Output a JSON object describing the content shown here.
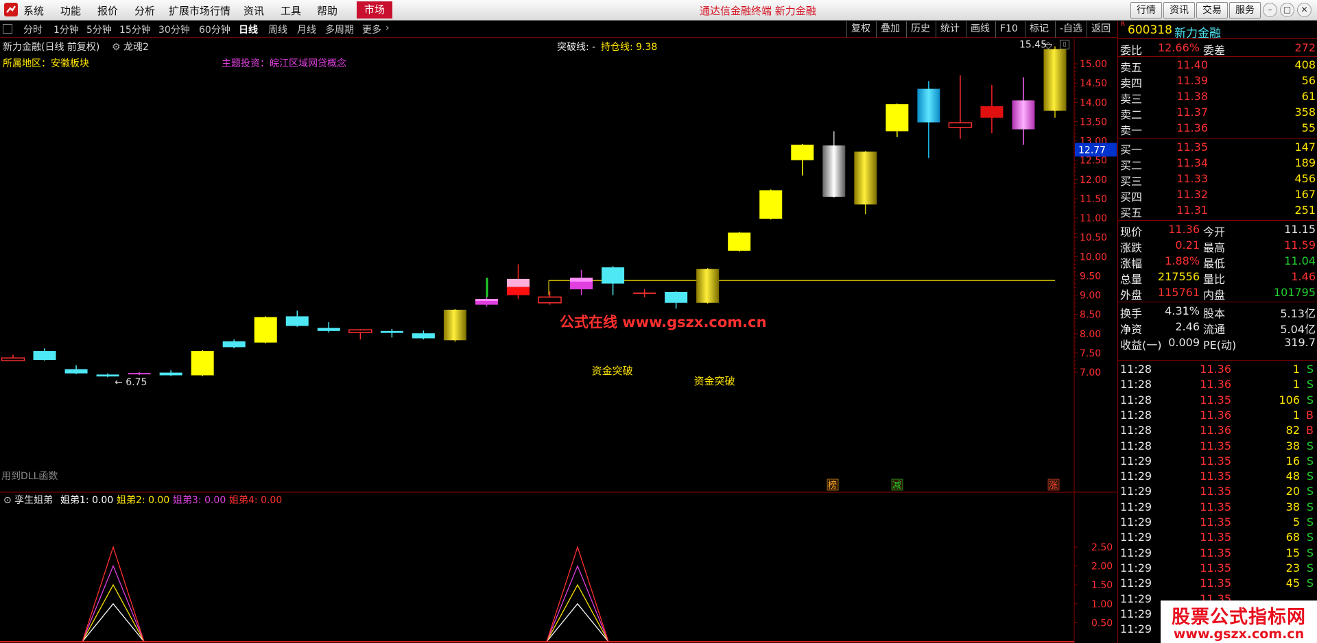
{
  "menubar": {
    "items": [
      "系统",
      "功能",
      "报价",
      "分析",
      "扩展市场行情",
      "资讯",
      "工具",
      "帮助"
    ],
    "market_tab": "市场",
    "center_title": "通达信金融终端  新力金融",
    "right_buttons": [
      "行情",
      "资讯",
      "交易",
      "服务"
    ]
  },
  "periodbar": {
    "items": [
      "分时",
      "1分钟",
      "5分钟",
      "15分钟",
      "30分钟",
      "60分钟",
      "日线",
      "周线",
      "月线",
      "多周期",
      "更多"
    ],
    "active": "日线",
    "tools": [
      "复权",
      "叠加",
      "历史",
      "统计",
      "画线",
      "F10",
      "标记",
      "-自选",
      "返回"
    ]
  },
  "chart": {
    "title": "新力金融(日线 前复权)",
    "indicator_tag": "龙魂2",
    "region_label": "所属地区：安徽板块",
    "theme_label": "主题投资：皖江区域网贷概念",
    "breakout_label": "突破线: -",
    "hold_label": "持仓线: 9.38",
    "watermark": "公式在线  www.gszx.com.cn",
    "dll_label": "用到DLL函数",
    "price_axis": [
      "15.00",
      "14.50",
      "14.00",
      "13.50",
      "13.00",
      "12.50",
      "12.00",
      "11.50",
      "11.00",
      "10.50",
      "10.00",
      "9.50",
      "9.00",
      "8.50",
      "8.00",
      "7.50",
      "7.00"
    ],
    "current_price_tag": "12.77",
    "high_label": "15.45",
    "low_label": "6.75",
    "signal_labels": [
      "资金突破",
      "资金突破"
    ],
    "bottom_markers": [
      "榜",
      "减",
      "涨"
    ],
    "hold_line_value": 9.38,
    "candles": [
      {
        "o": 7.37,
        "c": 7.33,
        "h": 7.45,
        "l": 7.3,
        "col": "#ff3030",
        "hollow": true
      },
      {
        "o": 7.55,
        "c": 7.32,
        "h": 7.62,
        "l": 7.3,
        "col": "#4ee8f5"
      },
      {
        "o": 7.08,
        "c": 6.97,
        "h": 7.18,
        "l": 6.95,
        "col": "#4ee8f5"
      },
      {
        "o": 6.94,
        "c": 6.89,
        "h": 6.97,
        "l": 6.87,
        "col": "#4ee8f5"
      },
      {
        "o": 6.95,
        "c": 6.98,
        "h": 7.0,
        "l": 6.93,
        "col": "#e040e0"
      },
      {
        "o": 6.99,
        "c": 6.92,
        "h": 7.05,
        "l": 6.9,
        "col": "#4ee8f5"
      },
      {
        "o": 6.92,
        "c": 7.55,
        "h": 7.57,
        "l": 6.9,
        "col": "#ffff00"
      },
      {
        "o": 7.8,
        "c": 7.65,
        "h": 7.85,
        "l": 7.62,
        "col": "#4ee8f5"
      },
      {
        "o": 7.77,
        "c": 8.43,
        "h": 8.45,
        "l": 7.75,
        "col": "#ffff00"
      },
      {
        "o": 8.45,
        "c": 8.2,
        "h": 8.6,
        "l": 8.18,
        "col": "#4ee8f5"
      },
      {
        "o": 8.15,
        "c": 8.07,
        "h": 8.3,
        "l": 8.03,
        "col": "#4ee8f5"
      },
      {
        "o": 8.05,
        "c": 8.1,
        "h": 8.12,
        "l": 7.85,
        "col": "#ff3030",
        "hollow": true
      },
      {
        "o": 8.07,
        "c": 8.02,
        "h": 8.12,
        "l": 7.9,
        "col": "#4ee8f5"
      },
      {
        "o": 8.01,
        "c": 7.88,
        "h": 8.08,
        "l": 7.85,
        "col": "#4ee8f5"
      },
      {
        "o": 7.83,
        "c": 8.62,
        "h": 8.64,
        "l": 7.79,
        "col": "#d4c800",
        "grad": "gold"
      },
      {
        "o": 8.75,
        "c": 8.9,
        "h": 9.25,
        "l": 8.7,
        "col": "#e040e0",
        "shade": "magenta"
      },
      {
        "o": 9.0,
        "c": 9.42,
        "h": 9.8,
        "l": 8.9,
        "col": "#ff2020",
        "shade": "pink"
      },
      {
        "o": 8.95,
        "c": 8.8,
        "h": 9.1,
        "l": 8.75,
        "col": "#ff3030",
        "hollow": true
      },
      {
        "o": 9.15,
        "c": 9.45,
        "h": 9.65,
        "l": 9.0,
        "col": "#e040e0",
        "shade": "magenta"
      },
      {
        "o": 9.72,
        "c": 9.3,
        "h": 9.75,
        "l": 9.0,
        "col": "#4ee8f5"
      },
      {
        "o": 9.05,
        "c": 9.05,
        "h": 9.15,
        "l": 8.95,
        "col": "#ff3030",
        "doji": true
      },
      {
        "o": 9.08,
        "c": 8.8,
        "h": 9.1,
        "l": 8.65,
        "col": "#4ee8f5"
      },
      {
        "o": 8.8,
        "c": 9.68,
        "h": 9.7,
        "l": 8.78,
        "col": "#d4c800",
        "grad": "gold"
      },
      {
        "o": 10.15,
        "c": 10.62,
        "h": 10.64,
        "l": 10.13,
        "col": "#ffff00"
      },
      {
        "o": 10.98,
        "c": 11.72,
        "h": 11.74,
        "l": 10.96,
        "col": "#ffff00"
      },
      {
        "o": 12.5,
        "c": 12.9,
        "h": 12.92,
        "l": 12.1,
        "col": "#ffff00"
      },
      {
        "o": 12.88,
        "c": 11.55,
        "h": 13.25,
        "l": 11.53,
        "col": "#cccccc",
        "grad": "silver"
      },
      {
        "o": 11.35,
        "c": 12.72,
        "h": 12.74,
        "l": 11.1,
        "col": "#d4c800",
        "grad": "gold"
      },
      {
        "o": 13.25,
        "c": 13.95,
        "h": 13.97,
        "l": 13.1,
        "col": "#ffff00"
      },
      {
        "o": 14.35,
        "c": 13.48,
        "h": 14.55,
        "l": 12.55,
        "col": "#1ec8ff",
        "grad": "cyan"
      },
      {
        "o": 13.47,
        "c": 13.35,
        "h": 14.7,
        "l": 13.05,
        "col": "#ff3030",
        "hollow": true
      },
      {
        "o": 13.9,
        "c": 13.6,
        "h": 14.45,
        "l": 13.2,
        "col": "#ff2020",
        "shade": "red"
      },
      {
        "o": 14.05,
        "c": 13.3,
        "h": 14.65,
        "l": 12.9,
        "col": "#ff66ff",
        "grad": "pink"
      },
      {
        "o": 13.78,
        "c": 15.38,
        "h": 15.45,
        "l": 13.6,
        "col": "#d4c800",
        "grad": "gold"
      }
    ],
    "sub": {
      "title": "孪生姐弟",
      "legend": [
        {
          "label": "姐弟1: 0.00",
          "color": "#ffffff"
        },
        {
          "label": "姐弟2: 0.00",
          "color": "#ffe600"
        },
        {
          "label": "姐弟3: 0.00",
          "color": "#e040e0"
        },
        {
          "label": "姐弟4: 0.00",
          "color": "#ff3030"
        }
      ],
      "axis": [
        "2.50",
        "2.00",
        "1.50",
        "1.00",
        "0.50"
      ],
      "peaks": [
        {
          "center": 165,
          "heights": [
            1.0,
            1.5,
            2.0,
            2.5
          ]
        },
        {
          "center": 842,
          "heights": [
            1.0,
            1.5,
            2.0,
            2.5
          ]
        }
      ]
    }
  },
  "quote": {
    "code": "600318",
    "name": "新力金融",
    "r_badge": "R",
    "weibi_label": "委比",
    "weibi": "12.66%",
    "weicha_label": "委差",
    "weicha": "272",
    "asks": [
      {
        "label": "卖五",
        "price": "11.40",
        "vol": "408"
      },
      {
        "label": "卖四",
        "price": "11.39",
        "vol": "56"
      },
      {
        "label": "卖三",
        "price": "11.38",
        "vol": "61"
      },
      {
        "label": "卖二",
        "price": "11.37",
        "vol": "358"
      },
      {
        "label": "卖一",
        "price": "11.36",
        "vol": "55"
      }
    ],
    "bids": [
      {
        "label": "买一",
        "price": "11.35",
        "vol": "147"
      },
      {
        "label": "买二",
        "price": "11.34",
        "vol": "189"
      },
      {
        "label": "买三",
        "price": "11.33",
        "vol": "456"
      },
      {
        "label": "买四",
        "price": "11.32",
        "vol": "167"
      },
      {
        "label": "买五",
        "price": "11.31",
        "vol": "251"
      }
    ],
    "stats1": [
      {
        "l1": "现价",
        "v1": "11.36",
        "c1": "red",
        "l2": "今开",
        "v2": "11.15",
        "c2": "white"
      },
      {
        "l1": "涨跌",
        "v1": "0.21",
        "c1": "red",
        "l2": "最高",
        "v2": "11.59",
        "c2": "red"
      },
      {
        "l1": "涨幅",
        "v1": "1.88%",
        "c1": "red",
        "l2": "最低",
        "v2": "11.04",
        "c2": "green"
      },
      {
        "l1": "总量",
        "v1": "217556",
        "c1": "yellow",
        "l2": "量比",
        "v2": "1.46",
        "c2": "red"
      },
      {
        "l1": "外盘",
        "v1": "115761",
        "c1": "red",
        "l2": "内盘",
        "v2": "101795",
        "c2": "green"
      }
    ],
    "stats2": [
      {
        "l1": "换手",
        "v1": "4.31%",
        "l2": "股本",
        "v2": "5.13亿"
      },
      {
        "l1": "净资",
        "v1": "2.46",
        "l2": "流通",
        "v2": "5.04亿"
      },
      {
        "l1": "收益(一)",
        "v1": "0.009",
        "l2": "PE(动)",
        "v2": "319.7"
      }
    ],
    "ticks": [
      {
        "t": "11:28",
        "p": "11.36",
        "v": "1",
        "bs": "S"
      },
      {
        "t": "11:28",
        "p": "11.36",
        "v": "1",
        "bs": "S"
      },
      {
        "t": "11:28",
        "p": "11.35",
        "v": "106",
        "bs": "S"
      },
      {
        "t": "11:28",
        "p": "11.36",
        "v": "1",
        "bs": "B"
      },
      {
        "t": "11:28",
        "p": "11.36",
        "v": "82",
        "bs": "B"
      },
      {
        "t": "11:28",
        "p": "11.35",
        "v": "38",
        "bs": "S"
      },
      {
        "t": "11:29",
        "p": "11.35",
        "v": "16",
        "bs": "S"
      },
      {
        "t": "11:29",
        "p": "11.35",
        "v": "48",
        "bs": "S"
      },
      {
        "t": "11:29",
        "p": "11.35",
        "v": "20",
        "bs": "S"
      },
      {
        "t": "11:29",
        "p": "11.35",
        "v": "38",
        "bs": "S"
      },
      {
        "t": "11:29",
        "p": "11.35",
        "v": "5",
        "bs": "S"
      },
      {
        "t": "11:29",
        "p": "11.35",
        "v": "68",
        "bs": "S"
      },
      {
        "t": "11:29",
        "p": "11.35",
        "v": "15",
        "bs": "S"
      },
      {
        "t": "11:29",
        "p": "11.35",
        "v": "23",
        "bs": "S"
      },
      {
        "t": "11:29",
        "p": "11.35",
        "v": "45",
        "bs": "S"
      },
      {
        "t": "11:29",
        "p": "11.35",
        "v": "",
        "bs": ""
      },
      {
        "t": "11:29",
        "p": "",
        "v": "",
        "bs": ""
      },
      {
        "t": "11:29",
        "p": "",
        "v": "",
        "bs": ""
      }
    ]
  },
  "ad_banner": {
    "line1": "股票公式指标网",
    "line2": "www.gszx.com.cn"
  }
}
